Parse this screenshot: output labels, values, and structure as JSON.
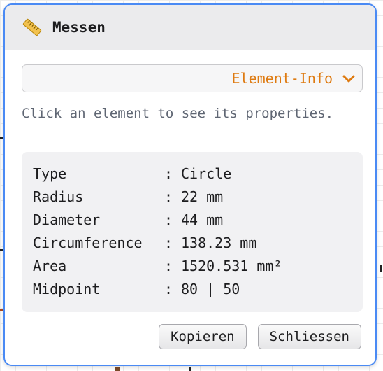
{
  "dialog": {
    "title": "Messen",
    "icon": "ruler-icon"
  },
  "mode_select": {
    "value": "Element-Info",
    "icon": "chevron-down-icon",
    "accent_color": "#de7a10"
  },
  "hint": "Click an element to see its properties.",
  "properties": [
    {
      "key": "Type",
      "sep": ":",
      "value": "Circle"
    },
    {
      "key": "Radius",
      "sep": ":",
      "value": "22 mm"
    },
    {
      "key": "Diameter",
      "sep": ":",
      "value": "44 mm"
    },
    {
      "key": "Circumference",
      "sep": ":",
      "value": "138.23 mm"
    },
    {
      "key": "Area",
      "sep": ":",
      "value": "1520.531 mm²"
    },
    {
      "key": "Midpoint",
      "sep": ":",
      "value": "80 | 50"
    }
  ],
  "buttons": {
    "copy_label": "Kopieren",
    "close_label": "Schliessen"
  }
}
